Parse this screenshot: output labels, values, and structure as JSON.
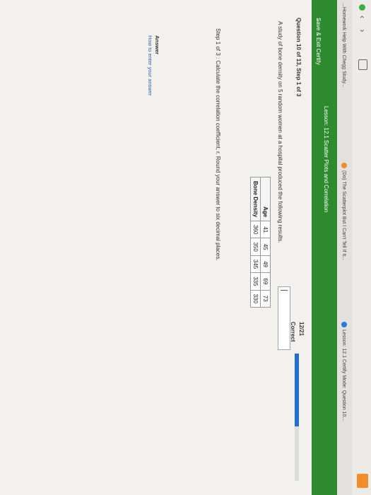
{
  "browser": {
    "tabs": [
      {
        "label": "...Homework Help With Chegg Study..."
      },
      {
        "label": "(Do) The Scatterplot But I Can't Tell If It..."
      },
      {
        "label": "Lesson: 12.1 Certify Mode: Question 10..."
      }
    ]
  },
  "header": {
    "save_exit": "Save & Exit Certify",
    "lesson": "Lesson: 12.1 Scatter Plots and Correlation"
  },
  "progress": {
    "score_label": "12/21",
    "status": "Correct",
    "fraction": 0.57
  },
  "question": {
    "title": "Question 10 of 13, Step 1 of 3",
    "prompt": "A study of bone density on 5 random women at a hospital produced the following results.",
    "step": "Step 1 of 3 : Calculate the correlation coefficient, r. Round your answer to six decimal places."
  },
  "table": {
    "row_headers": [
      "Age",
      "Bone Density"
    ],
    "ages": [
      "41",
      "45",
      "49",
      "69",
      "73"
    ],
    "densities": [
      "360",
      "350",
      "345",
      "335",
      "330"
    ]
  },
  "answer": {
    "label": "Answer",
    "help_link": "How to enter your answer"
  },
  "colors": {
    "header_green": "#2e8a2e",
    "progress_blue": "#1f6fd0"
  }
}
